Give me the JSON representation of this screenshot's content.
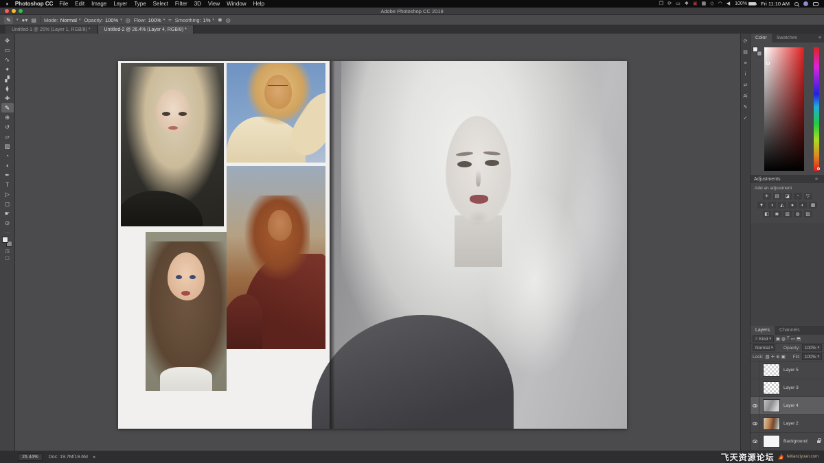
{
  "menu_bar": {
    "apple": "",
    "app_name": "Photoshop CC",
    "items": [
      "File",
      "Edit",
      "Image",
      "Layer",
      "Type",
      "Select",
      "Filter",
      "3D",
      "View",
      "Window",
      "Help"
    ],
    "status_icons": [
      {
        "name": "window",
        "glyph": "❐"
      },
      {
        "name": "sync",
        "glyph": "⟳"
      },
      {
        "name": "display",
        "glyph": "▭"
      },
      {
        "name": "dropbox",
        "glyph": "❖"
      },
      {
        "name": "badge",
        "glyph": "▣",
        "color": "#b03540"
      },
      {
        "name": "keyboard",
        "glyph": "▦"
      },
      {
        "name": "bluetooth",
        "glyph": "◇"
      },
      {
        "name": "wifi",
        "glyph": "◠"
      },
      {
        "name": "volume",
        "glyph": "◀"
      }
    ],
    "battery": "100%",
    "clock": "Fri 11:10 AM"
  },
  "title_bar": {
    "title": "Adobe Photoshop CC 2018"
  },
  "options_bar": {
    "tool_glyph": "✎",
    "mode_label": "Mode:",
    "mode_value": "Normal",
    "opacity_label": "Opacity:",
    "opacity_value": "100%",
    "flow_label": "Flow:",
    "flow_value": "100%",
    "smoothing_label": "Smoothing:",
    "smoothing_value": "1%"
  },
  "document_tabs": [
    {
      "label": "Untitled-1 @ 25% (Layer 1, RGB/8) *",
      "active": false
    },
    {
      "label": "Untitled-2 @ 26.4% (Layer 4, RGB/8) *",
      "active": true
    }
  ],
  "toolbar": {
    "tools": [
      {
        "name": "move",
        "glyph": "✥",
        "selected": false
      },
      {
        "name": "marquee",
        "glyph": "▭",
        "selected": false
      },
      {
        "name": "lasso",
        "glyph": "∿",
        "selected": false
      },
      {
        "name": "magic-wand",
        "glyph": "✦",
        "selected": false
      },
      {
        "name": "crop",
        "glyph": "▞",
        "selected": false
      },
      {
        "name": "eyedropper",
        "glyph": "⧫",
        "selected": false
      },
      {
        "name": "healing-brush",
        "glyph": "✚",
        "selected": false
      },
      {
        "name": "brush",
        "glyph": "✎",
        "selected": true
      },
      {
        "name": "clone-stamp",
        "glyph": "⊕",
        "selected": false
      },
      {
        "name": "history-brush",
        "glyph": "↺",
        "selected": false
      },
      {
        "name": "eraser",
        "glyph": "▱",
        "selected": false
      },
      {
        "name": "gradient",
        "glyph": "▨",
        "selected": false
      },
      {
        "name": "blur",
        "glyph": "◔",
        "selected": false
      },
      {
        "name": "dodge",
        "glyph": "◖",
        "selected": false
      },
      {
        "name": "pen",
        "glyph": "✒",
        "selected": false
      },
      {
        "name": "type",
        "glyph": "T",
        "selected": false
      },
      {
        "name": "path-selection",
        "glyph": "▷",
        "selected": false
      },
      {
        "name": "shape",
        "glyph": "◻",
        "selected": false
      },
      {
        "name": "hand",
        "glyph": "☛",
        "selected": false
      },
      {
        "name": "zoom",
        "glyph": "⊙",
        "selected": false
      }
    ]
  },
  "dock_icons": [
    {
      "name": "history",
      "glyph": "⟳"
    },
    {
      "name": "libraries",
      "glyph": "▤"
    },
    {
      "name": "properties",
      "glyph": "≡"
    },
    {
      "name": "info",
      "glyph": "i"
    },
    {
      "name": "exchange",
      "glyph": "⇄"
    },
    {
      "name": "adobe-stock",
      "glyph": "Ai"
    },
    {
      "name": "brush-settings",
      "glyph": "✎"
    },
    {
      "name": "snapshot",
      "glyph": "✓"
    }
  ],
  "color_panel": {
    "tab_color": "Color",
    "tab_swatches": "Swatches"
  },
  "adjustments_panel": {
    "title": "Adjustments",
    "subtitle": "Add an adjustment",
    "rows": [
      [
        "☀",
        "▤",
        "◪",
        "◔",
        "▽"
      ],
      [
        "▼",
        "◑",
        "◭",
        "●",
        "◐",
        "▦"
      ],
      [
        "◧",
        "◙",
        "▥",
        "◍",
        "▨"
      ]
    ]
  },
  "layers_panel": {
    "tab_layers": "Layers",
    "tab_channels": "Channels",
    "filter_label": "Kind",
    "filter_icons": [
      "▣",
      "◍",
      "T",
      "▭",
      "⬒"
    ],
    "blend_mode": "Normal",
    "opacity_label": "Opacity:",
    "opacity_value": "100%",
    "lock_label": "Lock:",
    "lock_icons": [
      "▨",
      "✛",
      "⊕",
      "▣"
    ],
    "fill_label": "Fill:",
    "fill_value": "100%",
    "items": [
      {
        "name": "Layer 5",
        "visible": false,
        "selected": false,
        "thumb": "transparent",
        "locked": false
      },
      {
        "name": "Layer 3",
        "visible": false,
        "selected": false,
        "thumb": "transparent",
        "locked": false
      },
      {
        "name": "Layer 4",
        "visible": true,
        "selected": true,
        "thumb": "painting",
        "locked": false
      },
      {
        "name": "Layer 2",
        "visible": true,
        "selected": false,
        "thumb": "photos",
        "locked": false
      },
      {
        "name": "Background",
        "visible": true,
        "selected": false,
        "thumb": "white",
        "locked": true
      }
    ]
  },
  "status_bar": {
    "zoom": "26.44%",
    "doc_info": "Doc: 19.7M/19.6M"
  },
  "watermark": {
    "text": "飞天资源论坛",
    "sub": "feitianziyuan.com"
  },
  "colors": {
    "traffic_red": "#ff5f57",
    "traffic_yellow": "#febc2e",
    "traffic_green": "#28c840",
    "hue_red": "#e02020"
  }
}
